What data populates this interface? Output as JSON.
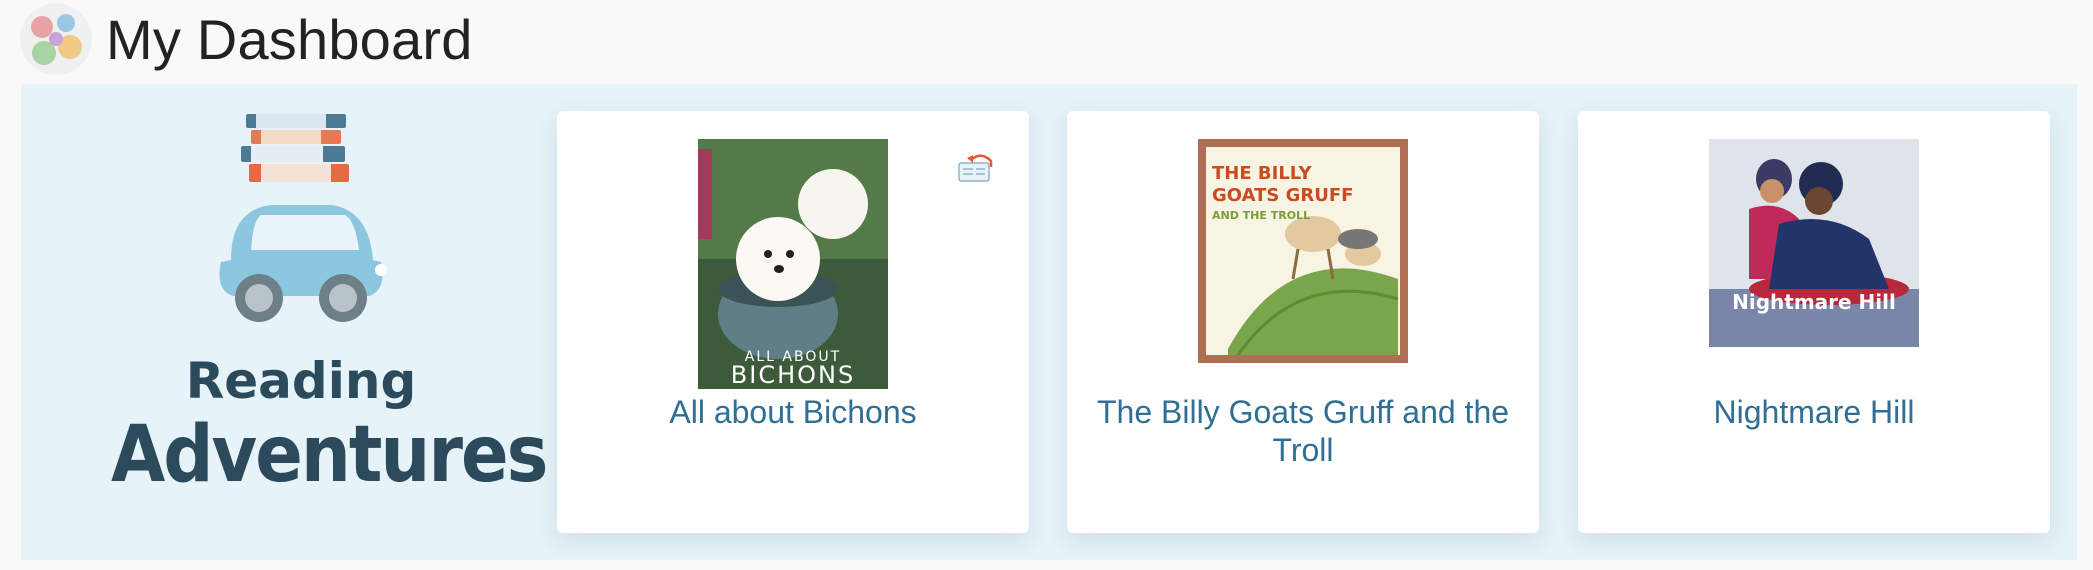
{
  "header": {
    "title": "My Dashboard"
  },
  "logo": {
    "line1": "Reading",
    "line2": "Adventures"
  },
  "books": [
    {
      "title": "All about Bichons",
      "cover_text_top": "ALL ABOUT",
      "cover_text_bottom": "BICHONS"
    },
    {
      "title": "The Billy Goats Gruff and the Troll",
      "cover_text_1": "THE BILLY",
      "cover_text_2": "GOATS GRUFF",
      "cover_text_3": "AND THE TROLL"
    },
    {
      "title": "Nightmare Hill",
      "cover_text": "Nightmare Hill"
    }
  ]
}
